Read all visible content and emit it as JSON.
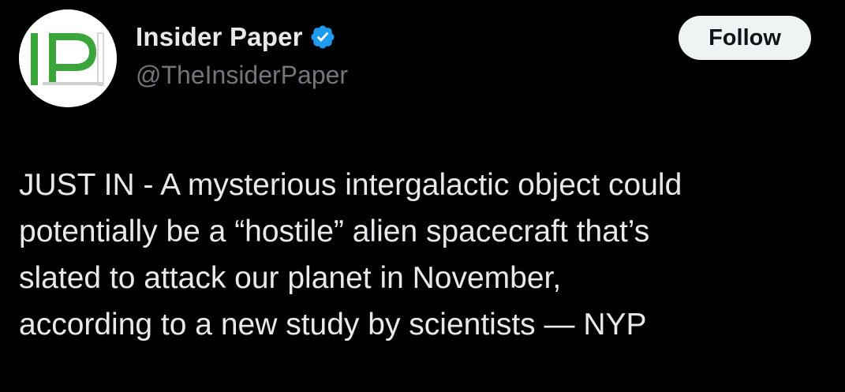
{
  "author": {
    "avatar_text": "IP",
    "avatar_icon": "insider-paper-logo",
    "display_name": "Insider Paper",
    "verified_icon": "verified-badge-icon",
    "handle": "@TheInsiderPaper"
  },
  "actions": {
    "follow_label": "Follow"
  },
  "tweet": {
    "text": "JUST IN - A mysterious intergalactic object could\npotentially be a “hostile” alien spacecraft that’s\nslated to attack our planet in November,\naccording to a new study by scientists — NYP"
  },
  "colors": {
    "background": "#000000",
    "text_primary": "#e7e9ea",
    "text_secondary": "#71767b",
    "verified_blue": "#1d9bf0",
    "logo_green": "#3aa53a",
    "follow_bg": "#eff3f4"
  }
}
